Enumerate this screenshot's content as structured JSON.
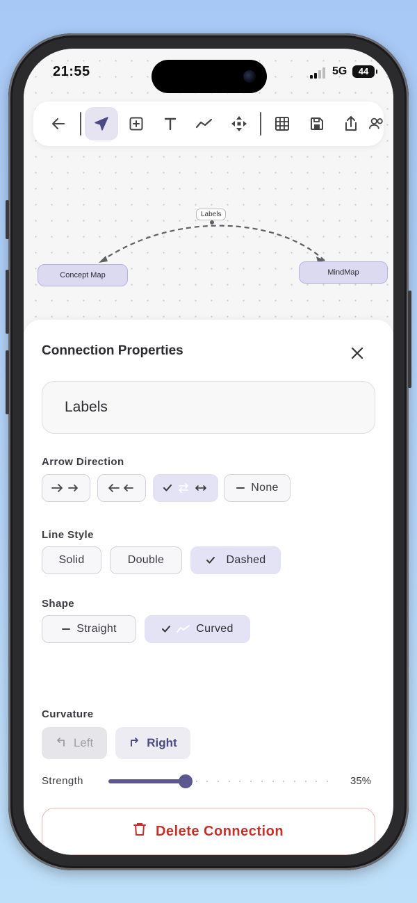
{
  "status_bar": {
    "time": "21:55",
    "network": "5G",
    "battery": "44"
  },
  "toolbar": {
    "items": [
      {
        "icon": "back-arrow-icon"
      },
      {
        "icon": "pointer-icon",
        "active": true
      },
      {
        "icon": "add-box-icon"
      },
      {
        "icon": "text-icon"
      },
      {
        "icon": "line-chart-icon"
      },
      {
        "icon": "move-icon"
      },
      {
        "icon": "grid-icon"
      },
      {
        "icon": "save-icon"
      },
      {
        "icon": "share-icon"
      },
      {
        "icon": "people-icon"
      }
    ]
  },
  "diagram": {
    "nodes": [
      {
        "label": "Concept Map"
      },
      {
        "label": "MindMap"
      }
    ],
    "edge_label": "Labels",
    "accent": "#5b588f",
    "node_fill": "#dcdaf0"
  },
  "panel": {
    "title": "Connection Properties",
    "label_value": "Labels",
    "arrow_direction": {
      "heading": "Arrow Direction",
      "options": [
        {
          "label": "",
          "icon": "arrow-forward-icon",
          "selected": false
        },
        {
          "label": "",
          "icon": "arrow-backward-icon",
          "selected": false
        },
        {
          "label": "",
          "icon": "arrow-both-icon",
          "selected": true
        },
        {
          "label": "None",
          "icon": "minus-icon",
          "selected": false
        }
      ]
    },
    "line_style": {
      "heading": "Line Style",
      "options": [
        {
          "label": "Solid",
          "selected": false
        },
        {
          "label": "Double",
          "selected": false
        },
        {
          "label": "Dashed",
          "selected": true
        }
      ]
    },
    "shape": {
      "heading": "Shape",
      "options": [
        {
          "label": "Straight",
          "selected": false
        },
        {
          "label": "Curved",
          "selected": true
        }
      ]
    },
    "curvature": {
      "heading": "Curvature",
      "options": [
        {
          "label": "Left",
          "selected": false
        },
        {
          "label": "Right",
          "selected": true
        }
      ]
    },
    "strength": {
      "label": "Strength",
      "value": 0.35,
      "value_text": "35%"
    },
    "delete_label": "Delete Connection",
    "delete_color": "#c4312b"
  }
}
